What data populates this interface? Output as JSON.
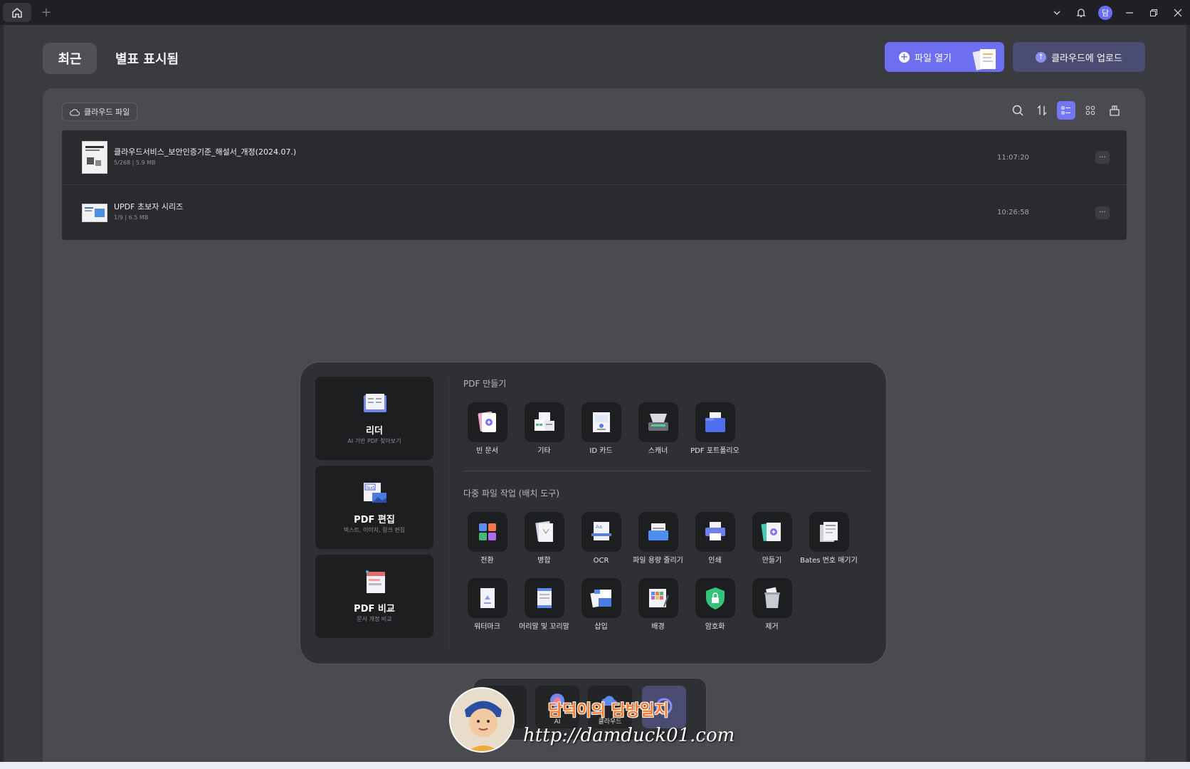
{
  "titlebar": {
    "home_icon": "home-icon",
    "new_tab": "+",
    "user_initial": "담"
  },
  "tabs": {
    "recent": "최근",
    "starred": "별표 표시됨"
  },
  "actions": {
    "open_file": "파일 열기",
    "upload_cloud": "클라우드에 업로드"
  },
  "panel": {
    "cloud_files": "클라우드 파일"
  },
  "files": [
    {
      "name": "클라우드서비스_보안인증기준_해설서_개정(2024.07.)",
      "meta": "5/268 | 5.9 MB",
      "time": "11:07:20"
    },
    {
      "name": "UPDF 초보자 시리즈",
      "meta": "1/9 | 6.5 MB",
      "time": "10:26:58"
    }
  ],
  "cards": [
    {
      "title": "리더",
      "sub": "AI 기반 PDF 찾아보기"
    },
    {
      "title": "PDF 편집",
      "sub": "텍스트, 이미지, 링크 편집"
    },
    {
      "title": "PDF 비교",
      "sub": "문서 개정 비교"
    }
  ],
  "create": {
    "title": "PDF 만들기",
    "items": [
      "빈 문서",
      "기타",
      "ID 카드",
      "스캐너",
      "PDF 포트폴리오"
    ]
  },
  "batch": {
    "title": "다중 파일 작업 (배치 도구)",
    "row1": [
      "전환",
      "병합",
      "OCR",
      "파일 용량 줄리기",
      "인쇄",
      "만들기",
      "Bates 번호 매기기"
    ],
    "row2": [
      "워터마크",
      "머리말 및 꼬리말",
      "삽입",
      "배경",
      "암호화",
      "제거"
    ]
  },
  "dock": {
    "ai": "AI",
    "cloud": "클라우드"
  },
  "watermark": {
    "title": "담덕이의 담방일지",
    "url": "http://damduck01.com"
  },
  "colors": {
    "accent": "#6d6ff0",
    "bg": "#3a3b3e",
    "panel": "#4a4b4f"
  }
}
